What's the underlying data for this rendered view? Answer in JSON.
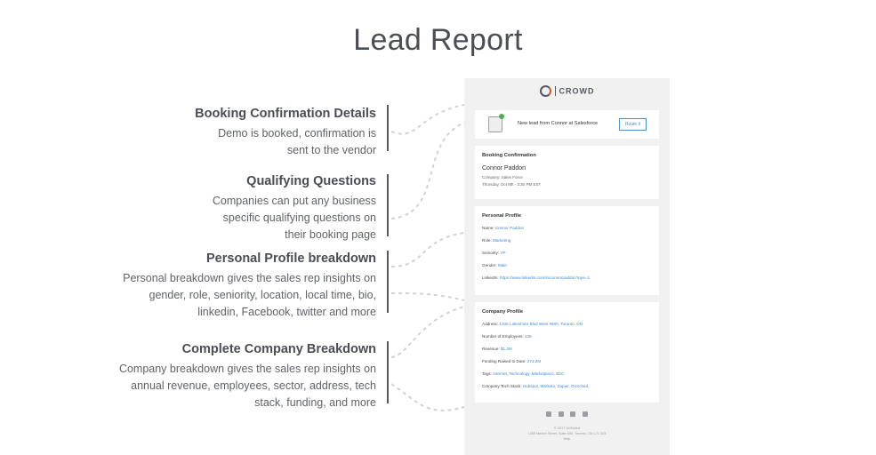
{
  "title": "Lead Report",
  "features": [
    {
      "heading": "Booking Confirmation Details",
      "lines": [
        "Demo is booked, confirmation is",
        "sent to the vendor"
      ]
    },
    {
      "heading": "Qualifying Questions",
      "lines": [
        "Companies can put any business",
        "specific qualifying questions on",
        "their booking page"
      ]
    },
    {
      "heading": "Personal Profile breakdown",
      "lines": [
        "Personal breakdown gives the sales rep insights on",
        "gender, role, seniority, location, local time, bio,",
        "linkedin, Facebook, twitter and more"
      ]
    },
    {
      "heading": "Complete Company Breakdown",
      "lines": [
        "Company breakdown gives the sales rep insights on",
        "annual revenue, employees, sector, address, tech",
        "stack, funding, and more"
      ]
    }
  ],
  "email": {
    "logo_text": "CROWD",
    "notification": {
      "message": "New lead from Connor at Salesforce",
      "button": "Route it"
    },
    "booking": {
      "heading": "Booking Confirmation",
      "name": "Connor Paddon",
      "company": "Company: Sales Force",
      "datetime": "Thursday, Oct 9th - 3:30 PM EST"
    },
    "personal": {
      "heading": "Personal Profile",
      "rows": [
        {
          "label": "Name: ",
          "value": "Connor Paddon"
        },
        {
          "label": "Role: ",
          "value": "Marketing"
        },
        {
          "label": "Seniority: ",
          "value": "VP"
        },
        {
          "label": "Gender: ",
          "value": "Male"
        },
        {
          "label": "LinkedIn: ",
          "value": "https://www.linkedin.com/in/connorpaddon?ppe=1"
        }
      ]
    },
    "company": {
      "heading": "Company Profile",
      "rows": [
        {
          "label": "Address: ",
          "value": "1335 Lakeshore Blvd West #600, Toronto, ON"
        },
        {
          "label": "Number of Employees: ",
          "value": "128"
        },
        {
          "label": "Revenue: ",
          "value": "$1.2M"
        },
        {
          "label": "Funding Raised to Date: ",
          "value": "273.2M"
        },
        {
          "label": "Tags: ",
          "value": "Internet, Technology, Marketplace, B2C"
        },
        {
          "label": "Company Tech Stack: ",
          "value": "Hubspot, Marketo, Zapier, OnSched,"
        }
      ]
    },
    "social_icons": [
      "facebook-icon",
      "twitter-icon",
      "instagram-icon",
      "youtube-icon"
    ],
    "footer": [
      "© 2017 OnSched",
      "1355 Market Street, Suite 600, Toronto, ON L7L 3Z3",
      "Help"
    ]
  },
  "colors": {
    "link": "#3d8bd8",
    "accent": "#4a90d9",
    "panel": "#f1f1f1"
  }
}
